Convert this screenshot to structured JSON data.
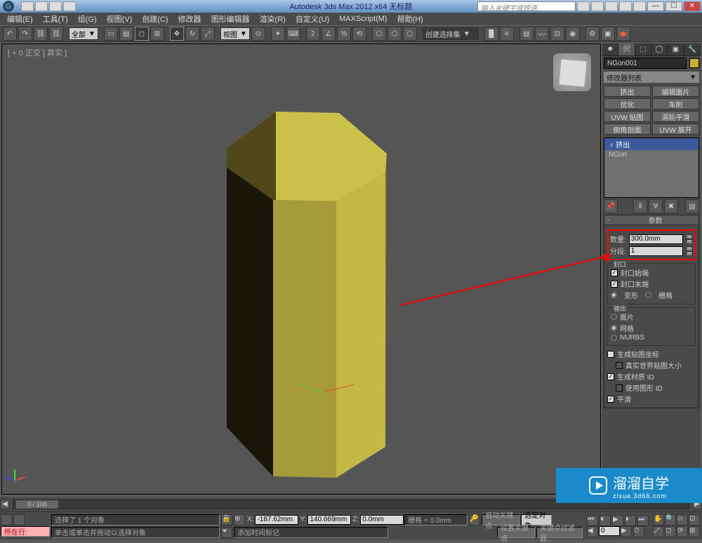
{
  "title": "Autodesk 3ds Max 2012 x64   无标题",
  "search_placeholder": "输入关键字或短语",
  "menu": [
    "编辑(E)",
    "工具(T)",
    "组(G)",
    "视图(V)",
    "创建(C)",
    "修改器",
    "图形编辑器",
    "渲染(R)",
    "自定义(U)",
    "MAXScript(M)",
    "帮助(H)"
  ],
  "toolbar_dropdown_all": "全部",
  "toolbar_dropdown_view": "视图",
  "toolbar_dropdown_select": "创建选择集",
  "viewport_label": "[ + 0 正交 ] 真实 ]",
  "object_name": "NGon001",
  "modifier_list_label": "修改器列表",
  "mod_buttons": [
    "挤出",
    "编辑面片",
    "优化",
    "车削",
    "UVW 贴图",
    "涡轮平滑",
    "倒角剖面",
    "UVW 展开"
  ],
  "mod_stack": {
    "active": "挤出",
    "base": "NGon"
  },
  "rollout": {
    "title": "参数",
    "amount_label": "数量:",
    "amount_value": "300.0mm",
    "segments_label": "分段:",
    "segments_value": "1",
    "cap_group": "封口",
    "cap_start": "封口始端",
    "cap_end": "封口末端",
    "cap_morph": "变形",
    "cap_grid": "栅格",
    "output_group": "输出",
    "out_patch": "面片",
    "out_mesh": "网格",
    "out_nurbs": "NURBS",
    "gen_map": "生成贴图坐标",
    "real_world": "真实世界贴图大小",
    "gen_mat": "生成材质 ID",
    "use_shape": "使用图形 ID",
    "smooth": "平滑"
  },
  "timeline": {
    "pos": "0 / 100"
  },
  "status": {
    "selected": "选择了 1 个对象",
    "prompt": "单击或单击并拖动以选择对象",
    "x": "-187.62mm",
    "y": "140.669mm",
    "z": "0.0mm",
    "grid": "栅格 = 0.0mm",
    "auto_key": "自动关键点",
    "sel_filter": "选定对象",
    "set_key": "设置关键点",
    "key_filter": "关键点过滤器...",
    "now_row": "所在行:",
    "add_time": "添加时间标记"
  },
  "watermark": {
    "big": "溜溜自学",
    "small": "zixue.3d66.com"
  }
}
